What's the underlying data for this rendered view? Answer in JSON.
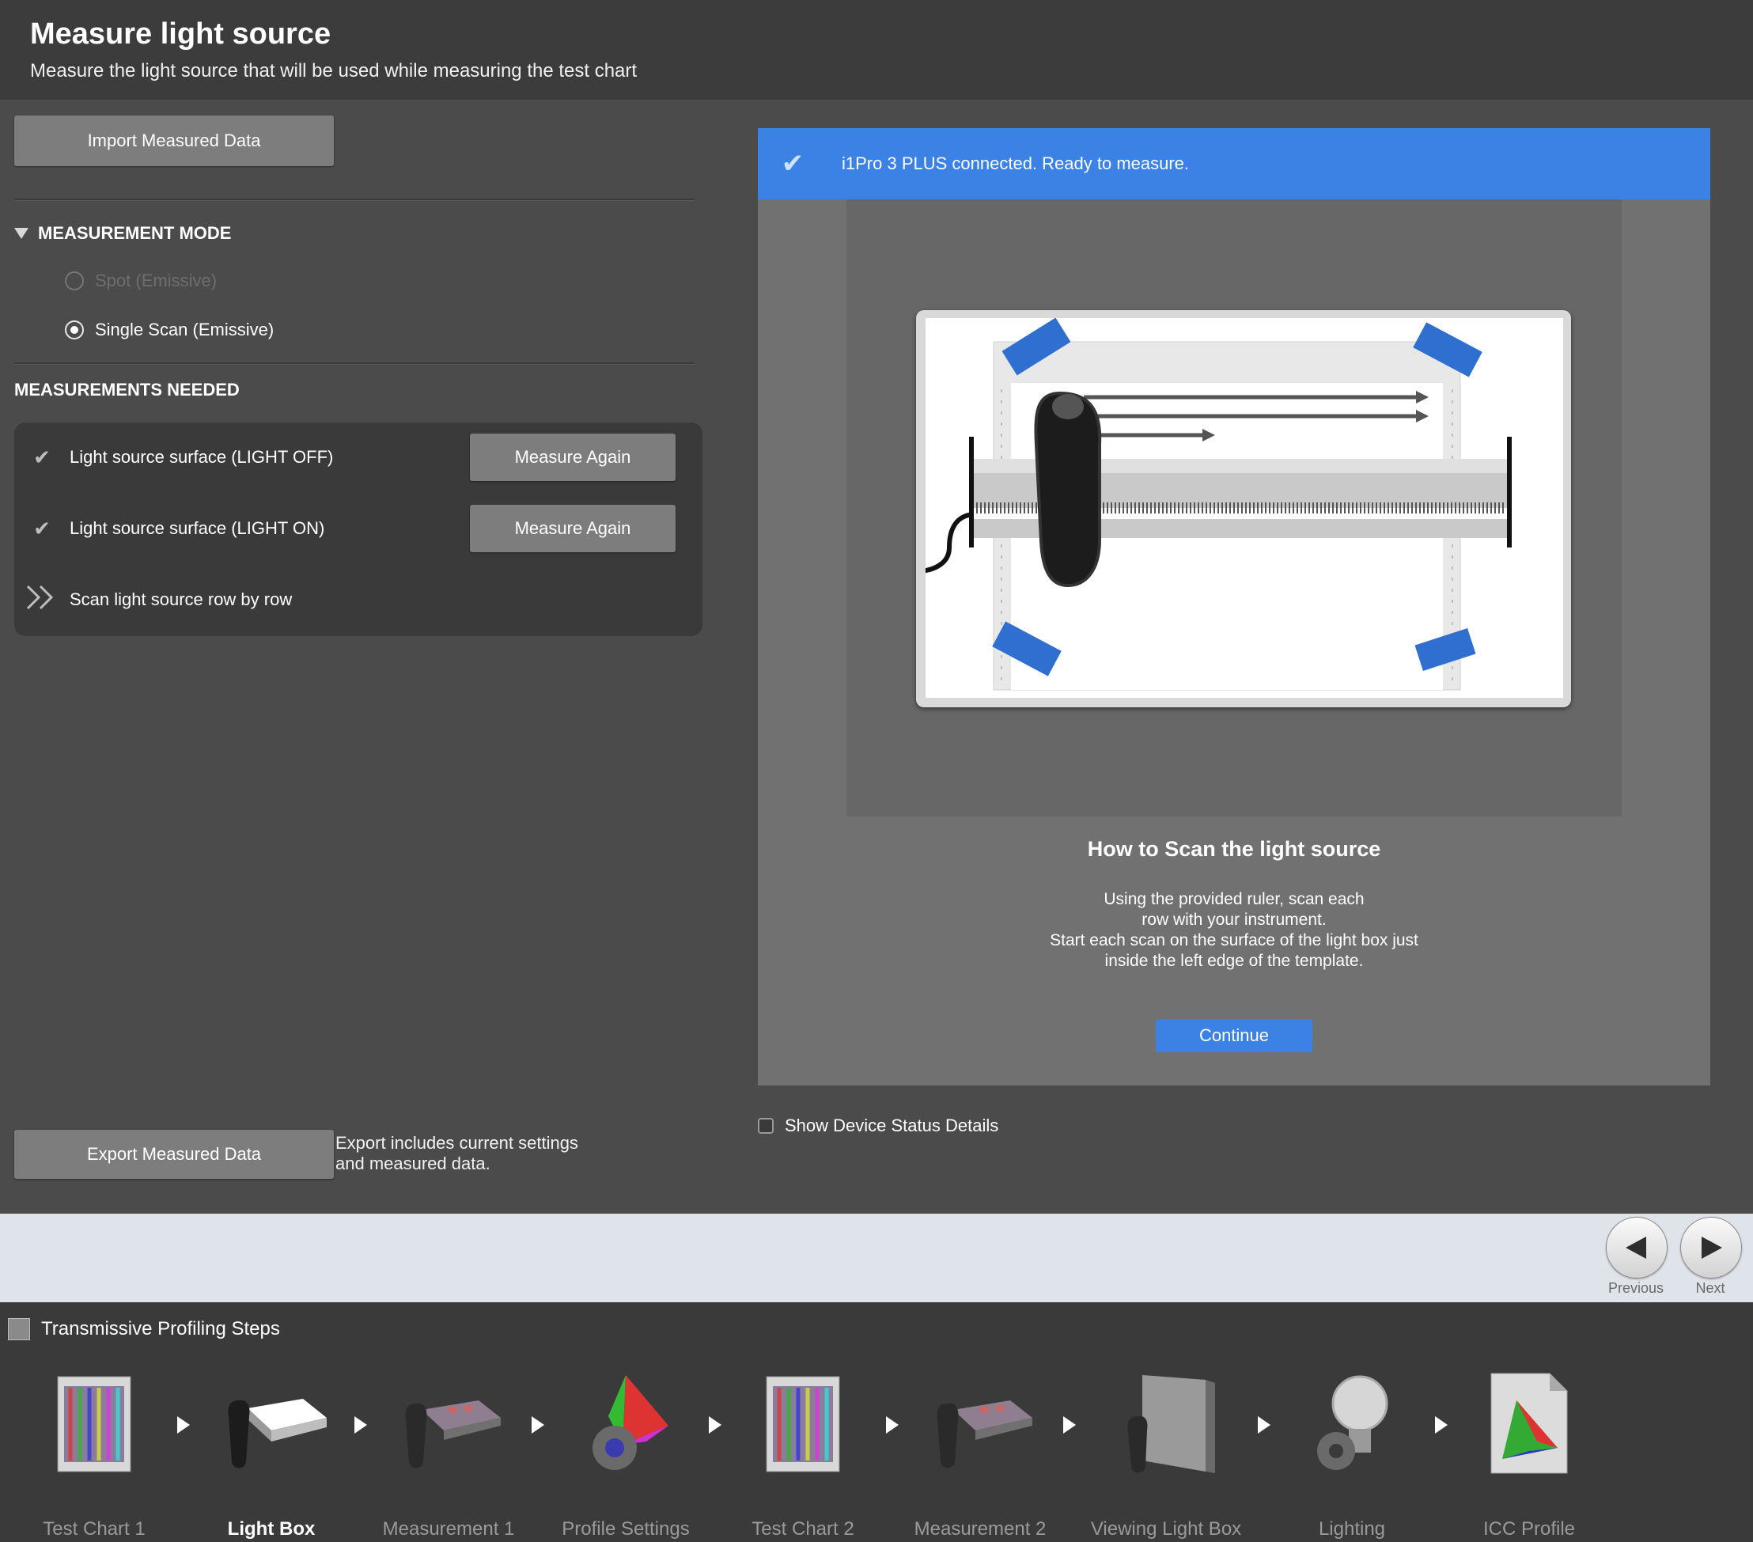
{
  "header": {
    "title": "Measure light source",
    "subtitle": "Measure the light source that will be used while measuring the test chart"
  },
  "left": {
    "import_label": "Import Measured Data",
    "measurement_mode": {
      "title": "MEASUREMENT MODE",
      "options": [
        {
          "label": "Spot (Emissive)",
          "selected": false,
          "enabled": false
        },
        {
          "label": "Single Scan (Emissive)",
          "selected": true,
          "enabled": true
        }
      ]
    },
    "measurements_needed": {
      "title": "MEASUREMENTS NEEDED",
      "items": [
        {
          "label": "Light source surface (LIGHT OFF)",
          "status": "done",
          "button": "Measure Again"
        },
        {
          "label": "Light source surface (LIGHT ON)",
          "status": "done",
          "button": "Measure Again"
        },
        {
          "label": "Scan light source row by row",
          "status": "current"
        }
      ]
    },
    "export_label": "Export Measured Data",
    "export_note": "Export includes current settings and measured data."
  },
  "right": {
    "status": "i1Pro 3 PLUS connected. Ready to measure.",
    "howto_title": "How to Scan the light source",
    "howto_text": "Using the provided ruler, scan each\nrow with your instrument.\nStart each scan on the surface of the light box just\ninside the left edge of the template.",
    "continue_label": "Continue",
    "show_status_label": "Show Device Status Details"
  },
  "nav": {
    "previous_label": "Previous",
    "next_label": "Next"
  },
  "steps": {
    "title": "Transmissive Profiling Steps",
    "items": [
      {
        "label": "Test Chart 1",
        "icon": "test-chart-icon",
        "active": false
      },
      {
        "label": "Light Box",
        "icon": "light-box-icon",
        "active": true
      },
      {
        "label": "Measurement 1",
        "icon": "measurement-icon",
        "active": false
      },
      {
        "label": "Profile Settings",
        "icon": "profile-settings-icon",
        "active": false
      },
      {
        "label": "Test Chart 2",
        "icon": "test-chart-icon",
        "active": false
      },
      {
        "label": "Measurement 2",
        "icon": "measurement-icon",
        "active": false
      },
      {
        "label": "Viewing Light Box",
        "icon": "viewing-light-box-icon",
        "active": false
      },
      {
        "label": "Lighting",
        "icon": "lighting-icon",
        "active": false
      },
      {
        "label": "ICC Profile",
        "icon": "icc-profile-icon",
        "active": false
      }
    ]
  },
  "colors": {
    "accent": "#3b82e4",
    "background": "#4b4b4b",
    "header": "#3c3c3c",
    "nav_bar": "#dfe3ea"
  }
}
